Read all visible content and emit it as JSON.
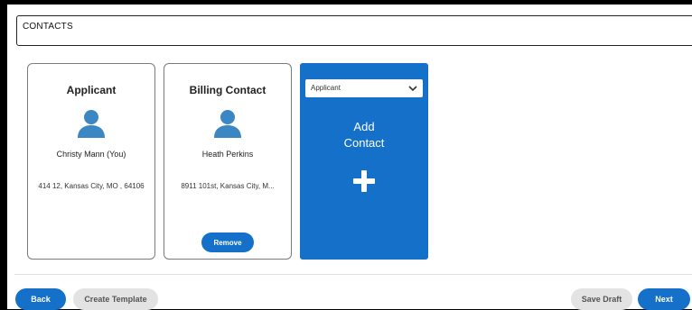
{
  "header": {
    "title": "CONTACTS"
  },
  "cards": [
    {
      "title": "Applicant",
      "name": "Christy Mann (You)",
      "address": "414 12, Kansas City, MO , 64106"
    },
    {
      "title": "Billing Contact",
      "name": "Heath Perkins",
      "address": "8911 101st, Kansas City, M...",
      "remove_label": "Remove"
    }
  ],
  "add_card": {
    "select_value": "Applicant",
    "label_line1": "Add",
    "label_line2": "Contact"
  },
  "footer": {
    "back_label": "Back",
    "create_template_label": "Create Template",
    "save_draft_label": "Save Draft",
    "next_label": "Next"
  },
  "colors": {
    "accent": "#1570c9",
    "avatar": "#3a87c3"
  },
  "icons": {
    "avatar": "person-icon",
    "add": "plus-icon",
    "select": "chevron-down-icon"
  }
}
